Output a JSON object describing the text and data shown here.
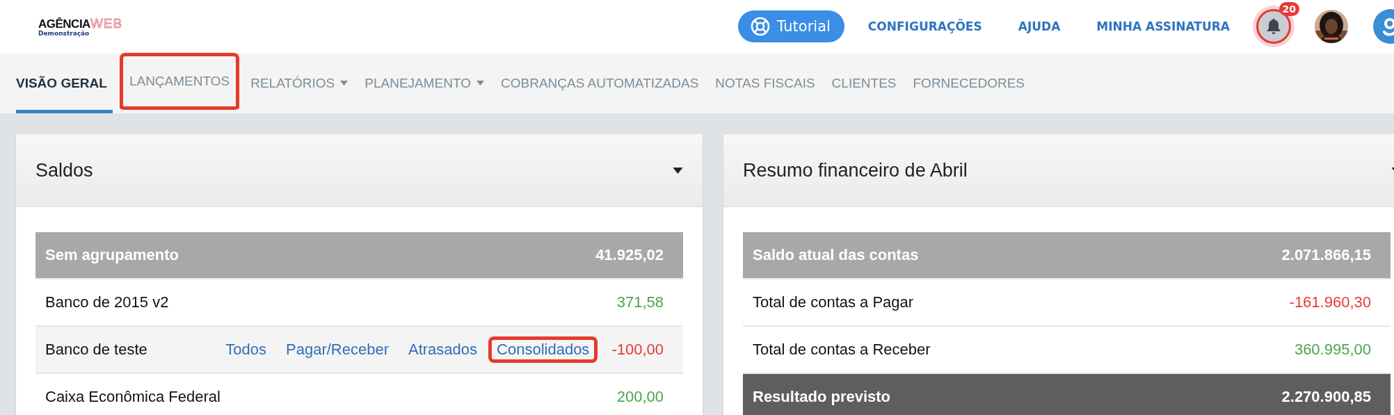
{
  "logo": {
    "name": "AGÊNCIA",
    "accent": "WEB",
    "subtitle": "Demonstração"
  },
  "top_bar": {
    "tutorial_button": "Tutorial",
    "links": [
      "CONFIGURAÇÕES",
      "AJUDA",
      "MINHA ASSINATURA"
    ],
    "notifications_badge": "20"
  },
  "nav_tabs": [
    {
      "label": "VISÃO GERAL",
      "selected": true,
      "dropdown": false,
      "highlighted": false
    },
    {
      "label": "LANÇAMENTOS",
      "selected": false,
      "dropdown": false,
      "highlighted": true
    },
    {
      "label": "RELATÓRIOS",
      "selected": false,
      "dropdown": true,
      "highlighted": false
    },
    {
      "label": "PLANEJAMENTO",
      "selected": false,
      "dropdown": true,
      "highlighted": false
    },
    {
      "label": "COBRANÇAS AUTOMATIZADAS",
      "selected": false,
      "dropdown": false,
      "highlighted": false
    },
    {
      "label": "NOTAS FISCAIS",
      "selected": false,
      "dropdown": false,
      "highlighted": false
    },
    {
      "label": "CLIENTES",
      "selected": false,
      "dropdown": false,
      "highlighted": false
    },
    {
      "label": "FORNECEDORES",
      "selected": false,
      "dropdown": false,
      "highlighted": false
    }
  ],
  "cards": [
    {
      "title": "Saldos",
      "rows": [
        {
          "kind": "group",
          "label": "Sem agrupamento",
          "value": "41.925,02",
          "color": "#ffffff"
        },
        {
          "kind": "item",
          "label": "Banco de 2015 v2",
          "value": "371,58",
          "color": "#4ba34b"
        },
        {
          "kind": "item",
          "label": "Banco de teste",
          "value": "-100,00",
          "color": "#e53935",
          "hover": true,
          "links": [
            {
              "label": "Todos",
              "highlighted": false
            },
            {
              "label": "Pagar/Receber",
              "highlighted": false
            },
            {
              "label": "Atrasados",
              "highlighted": false
            },
            {
              "label": "Consolidados",
              "highlighted": true
            }
          ]
        },
        {
          "kind": "item",
          "label": "Caixa Econômica Federal",
          "value": "200,00",
          "color": "#4ba34b"
        }
      ]
    },
    {
      "title": "Resumo financeiro de Abril",
      "rows": [
        {
          "kind": "group",
          "label": "Saldo atual das contas",
          "value": "2.071.866,15",
          "color": "#ffffff"
        },
        {
          "kind": "item",
          "label": "Total de contas a Pagar",
          "value": "-161.960,30",
          "color": "#e53935"
        },
        {
          "kind": "item",
          "label": "Total de contas a Receber",
          "value": "360.995,00",
          "color": "#4ba34b"
        },
        {
          "kind": "total",
          "label": "Resultado previsto",
          "value": "2.270.900,85",
          "color": "#ffffff"
        }
      ]
    }
  ]
}
